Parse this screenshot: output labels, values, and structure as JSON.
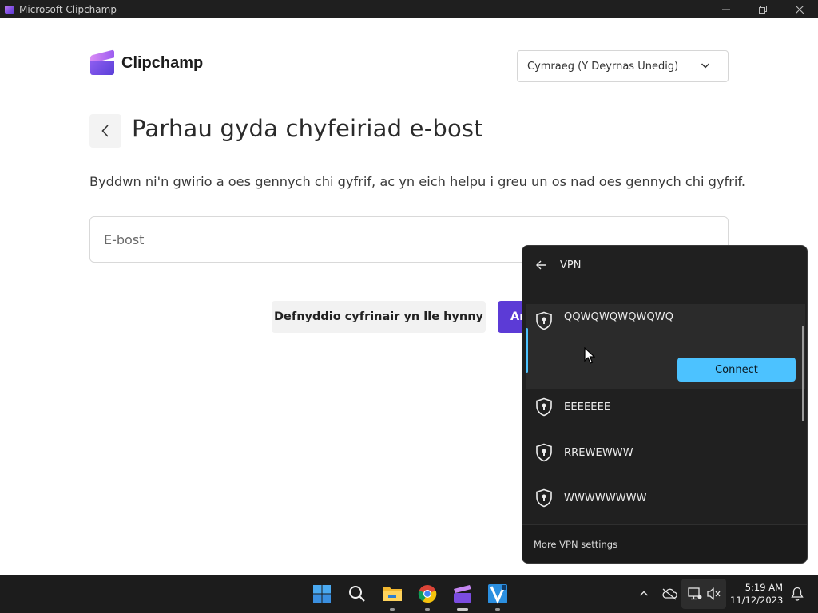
{
  "window": {
    "title": "Microsoft Clipchamp"
  },
  "brand": {
    "name": "Clipchamp"
  },
  "language": {
    "selected": "Cymraeg (Y Deyrnas Unedig)"
  },
  "page": {
    "title": "Parhau gyda chyfeiriad e-bost",
    "subtitle": "Byddwn ni'n gwirio a oes gennych chi gyfrif, ac yn eich helpu i greu un os nad oes gennych chi gyfrif.",
    "email_placeholder": "E-bost",
    "secondary_button": "Defnyddio cyfrinair yn lle hynny",
    "primary_button": "Ar"
  },
  "vpn": {
    "header": "VPN",
    "connections": [
      {
        "name": "QQWQWQWQWQWQ",
        "expanded": true
      },
      {
        "name": "EEEEEEE",
        "expanded": false
      },
      {
        "name": "RREWEWWW",
        "expanded": false
      },
      {
        "name": "WWWWWWWW",
        "expanded": false
      }
    ],
    "connect_label": "Connect",
    "footer_link": "More VPN settings"
  },
  "taskbar": {
    "apps": [
      "start-icon",
      "search-icon",
      "file-explorer-icon",
      "chrome-icon",
      "clipchamp-icon",
      "movie-maker-icon"
    ],
    "clock": {
      "time": "5:19 AM",
      "date": "11/12/2023"
    }
  },
  "colors": {
    "accent": "#5c3bd6",
    "vpn_accent": "#4cc2ff",
    "flyout_bg": "#202020"
  }
}
